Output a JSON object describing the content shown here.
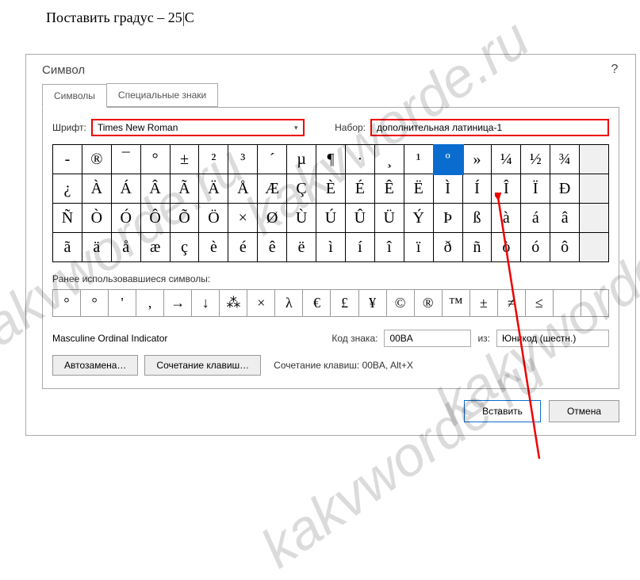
{
  "doc_text_prefix": "Поставить градус – 25",
  "doc_text_suffix": "C",
  "dialog_title": "Символ",
  "tabs": {
    "symbols": "Символы",
    "special": "Специальные знаки"
  },
  "font_label": "Шрифт:",
  "font_value": "Times New Roman",
  "set_label": "Набор:",
  "set_value": "дополнительная латиница-1",
  "grid": [
    [
      "-",
      "®",
      "¯",
      "°",
      "±",
      "²",
      "³",
      "´",
      "µ",
      "¶",
      "·",
      "¸",
      "¹",
      "º",
      "»",
      "¼",
      "½",
      "¾"
    ],
    [
      "¿",
      "À",
      "Á",
      "Â",
      "Ã",
      "Ä",
      "Å",
      "Æ",
      "Ç",
      "È",
      "É",
      "Ê",
      "Ë",
      "Ì",
      "Í",
      "Î",
      "Ï",
      "Ð"
    ],
    [
      "Ñ",
      "Ò",
      "Ó",
      "Ô",
      "Õ",
      "Ö",
      "×",
      "Ø",
      "Ù",
      "Ú",
      "Û",
      "Ü",
      "Ý",
      "Þ",
      "ß",
      "à",
      "á",
      "â"
    ],
    [
      "ã",
      "ä",
      "å",
      "æ",
      "ç",
      "è",
      "é",
      "ê",
      "ë",
      "ì",
      "í",
      "î",
      "ï",
      "ð",
      "ñ",
      "ò",
      "ó",
      "ô"
    ]
  ],
  "selected_char": "º",
  "recent_label": "Ранее использовавшиеся символы:",
  "recent": [
    "°",
    "°",
    "'",
    ",",
    "→",
    "↓",
    "⁂",
    "×",
    "λ",
    "€",
    "£",
    "¥",
    "©",
    "®",
    "™",
    "±",
    "≠",
    "≤"
  ],
  "char_name": "Masculine Ordinal Indicator",
  "code_label": "Код знака:",
  "code_value": "00BA",
  "from_label": "из:",
  "from_value": "Юникод (шестн.)",
  "autocorrect_btn": "Автозамена…",
  "shortcut_btn": "Сочетание клавиш…",
  "shortcut_text": "Сочетание клавиш: 00BA, Alt+X",
  "insert_btn": "Вставить",
  "cancel_btn": "Отмена",
  "watermark": "kakvworde.ru"
}
